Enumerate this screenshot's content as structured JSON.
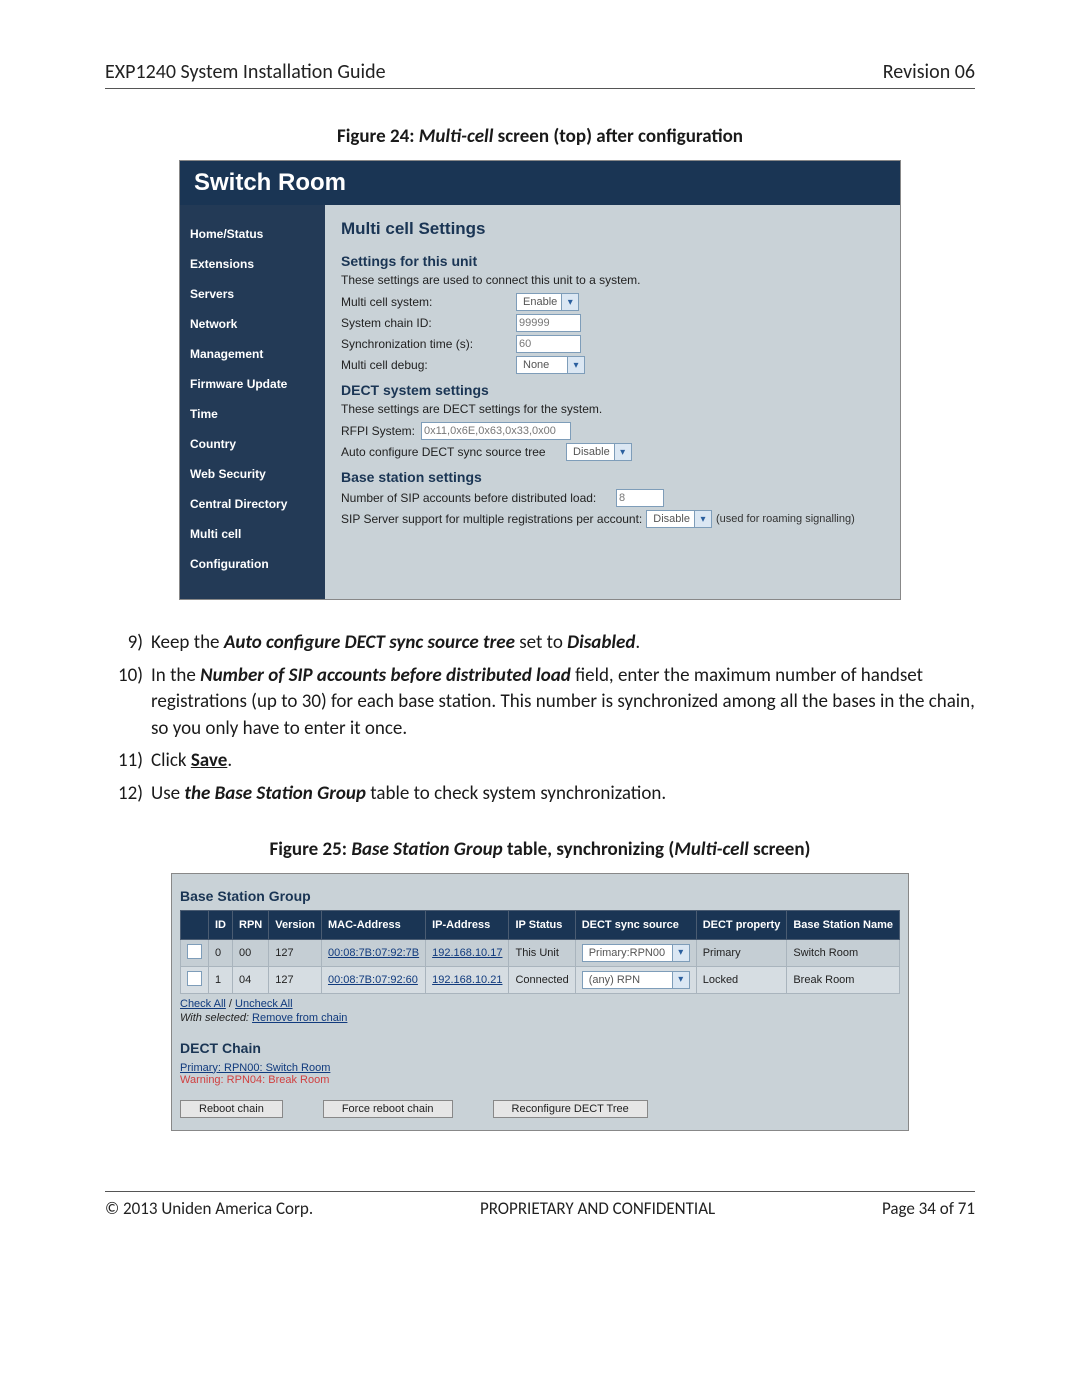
{
  "header": {
    "title": "EXP1240 System Installation Guide",
    "revision": "Revision 06"
  },
  "figure24": {
    "caption_prefix": "Figure 24: ",
    "caption_em": "Multi-cell",
    "caption_suffix": " screen (top) after configuration",
    "titlebar": "Switch Room",
    "nav": [
      "Home/Status",
      "Extensions",
      "Servers",
      "Network",
      "Management",
      "Firmware Update",
      "Time",
      "Country",
      "Web Security",
      "Central Directory",
      "Multi cell",
      "Configuration"
    ],
    "h1": "Multi cell Settings",
    "sec1_h": "Settings for this unit",
    "sec1_desc": "These settings are used to connect this unit to a system.",
    "rows1": {
      "multicell_label": "Multi cell system:",
      "multicell_val": "Enable",
      "chainid_label": "System chain ID:",
      "chainid_val": "99999",
      "synctime_label": "Synchronization time (s):",
      "synctime_val": "60",
      "debug_label": "Multi cell debug:",
      "debug_val": "None"
    },
    "sec2_h": "DECT system settings",
    "sec2_desc": "These settings are DECT settings for the system.",
    "rows2": {
      "rfpi_label": "RFPI System:",
      "rfpi_val": "0x11,0x6E,0x63,0x33,0x00",
      "autocfg_label": "Auto configure DECT sync source tree",
      "autocfg_val": "Disable"
    },
    "sec3_h": "Base station settings",
    "rows3": {
      "sip_before_label": "Number of SIP accounts before distributed load:",
      "sip_before_val": "8",
      "sip_multi_label": "SIP Server support for multiple registrations per account:",
      "sip_multi_val": "Disable",
      "sip_multi_note": "(used for roaming signalling)"
    }
  },
  "instructions": [
    {
      "n": "9)",
      "html": "Keep the <span class='bolditalic'>Auto configure DECT sync source tree</span> set to <span class='bolditalic'>Disabled</span>."
    },
    {
      "n": "10)",
      "html": "In the <span class='bolditalic'>Number of SIP accounts before distributed load</span> field, enter the maximum number of handset registrations (up to 30) for each base station. This number is synchronized among all the bases in the chain, so you only have to enter it once."
    },
    {
      "n": "11)",
      "html": "Click <span class='save'>Save</span>."
    },
    {
      "n": "12)",
      "html": "Use <span class='bolditalic'>the Base Station Group</span> table to check system synchronization."
    }
  ],
  "figure25": {
    "caption_prefix": "Figure 25: ",
    "caption_em": "Base Station Group",
    "caption_mid": " table, synchronizing (",
    "caption_em2": "Multi-cell",
    "caption_suffix": " screen)",
    "group_h": "Base Station Group",
    "headers": [
      "",
      "ID",
      "RPN",
      "Version",
      "MAC-Address",
      "IP-Address",
      "IP Status",
      "DECT sync source",
      "DECT property",
      "Base Station Name"
    ],
    "rows": [
      {
        "id": "0",
        "rpn": "00",
        "ver": "127",
        "mac": "00:08:7B:07:92:7B",
        "ip": "192.168.10.17",
        "status": "This Unit",
        "sync": "Primary:RPN00",
        "prop": "Primary",
        "name": "Switch Room"
      },
      {
        "id": "1",
        "rpn": "04",
        "ver": "127",
        "mac": "00:08:7B:07:92:60",
        "ip": "192.168.10.21",
        "status": "Connected",
        "sync": "(any) RPN",
        "prop": "Locked",
        "name": "Break Room"
      }
    ],
    "check_all": "Check All",
    "uncheck_all": "Uncheck All",
    "with_selected": "With selected: ",
    "remove_link": "Remove from chain",
    "dect_chain_h": "DECT Chain",
    "chain_primary": "Primary: RPN00: Switch Room",
    "chain_warning": "Warning: RPN04: Break Room",
    "buttons": [
      "Reboot chain",
      "Force reboot chain",
      "Reconfigure DECT Tree"
    ]
  },
  "footer": {
    "copyright": "© 2013 Uniden America Corp.",
    "notice": "PROPRIETARY AND CONFIDENTIAL",
    "page": "Page 34 of 71"
  }
}
